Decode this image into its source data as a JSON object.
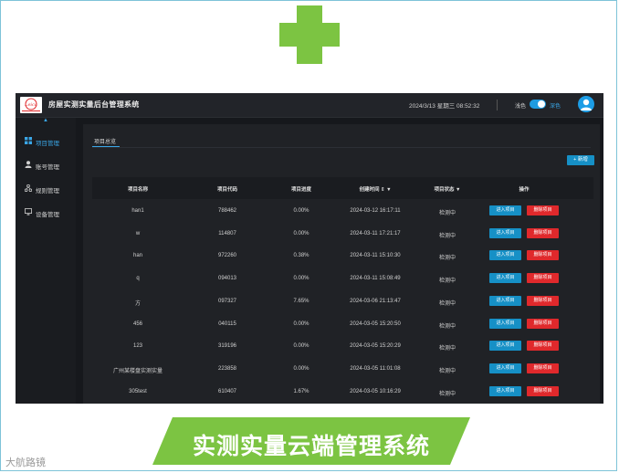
{
  "brand_color": "#7cc442",
  "accent_color": "#1690c6",
  "danger_color": "#e0292c",
  "header": {
    "logo_text": "Leica",
    "app_title": "房屋实测实量后台管理系统",
    "datetime": "2024/3/13  星期三   08:52:32",
    "theme_light_label": "浅色",
    "theme_dark_label": "深色",
    "theme_toggle_on": true
  },
  "sidebar": {
    "collapse_icon": "chevron-up-icon",
    "items": [
      {
        "label": "项目管理",
        "icon": "grid-icon",
        "active": true
      },
      {
        "label": "账号管理",
        "icon": "user-icon",
        "active": false
      },
      {
        "label": "规则管理",
        "icon": "rules-icon",
        "active": false
      },
      {
        "label": "设备管理",
        "icon": "device-icon",
        "active": false
      }
    ]
  },
  "main": {
    "tab": "项目总览",
    "add_button": "+ 新增",
    "columns": [
      "项目名称",
      "项目代码",
      "项目进度",
      "创建时间 ⇕ ▼",
      "项目状态 ▼",
      "操作"
    ],
    "rows": [
      {
        "name": "han1",
        "code": "788462",
        "progress": "0.00%",
        "created": "2024-03-12 16:17:11",
        "status": "检测中"
      },
      {
        "name": "w",
        "code": "114807",
        "progress": "0.00%",
        "created": "2024-03-11 17:21:17",
        "status": "检测中"
      },
      {
        "name": "han",
        "code": "972260",
        "progress": "0.38%",
        "created": "2024-03-11 15:10:30",
        "status": "检测中"
      },
      {
        "name": "q",
        "code": "094013",
        "progress": "0.00%",
        "created": "2024-03-11 15:08:49",
        "status": "检测中"
      },
      {
        "name": "方",
        "code": "097327",
        "progress": "7.65%",
        "created": "2024-03-06 21:13:47",
        "status": "检测中"
      },
      {
        "name": "456",
        "code": "040115",
        "progress": "0.00%",
        "created": "2024-03-05 15:20:50",
        "status": "检测中"
      },
      {
        "name": "123",
        "code": "319196",
        "progress": "0.00%",
        "created": "2024-03-05 15:20:29",
        "status": "检测中"
      },
      {
        "name": "广州某楼盘实测实量",
        "code": "223858",
        "progress": "0.00%",
        "created": "2024-03-05 11:01:08",
        "status": "检测中"
      },
      {
        "name": "305test",
        "code": "610407",
        "progress": "1.67%",
        "created": "2024-03-05 10:16:29",
        "status": "检测中"
      }
    ],
    "enter_label": "进入项目",
    "delete_label": "删除项目"
  },
  "banner": {
    "text": "实测实量云端管理系统"
  },
  "watermark": "大航路镜"
}
